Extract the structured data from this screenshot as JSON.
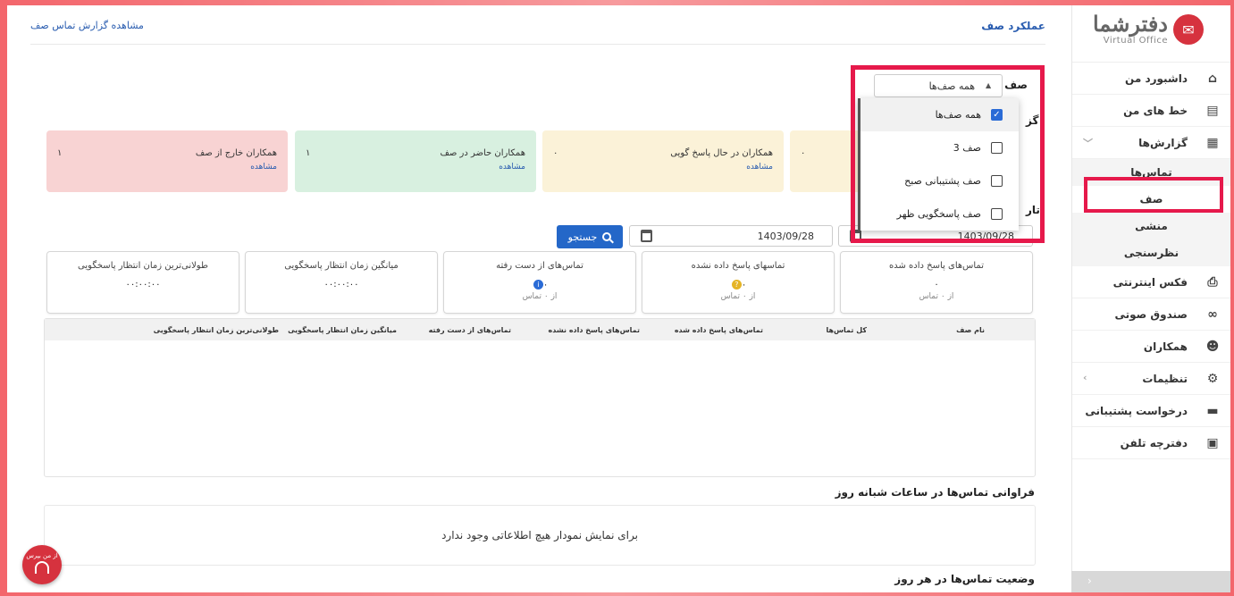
{
  "sidebar": {
    "logo_name": "دفترشما",
    "logo_sub": "Virtual Office",
    "items": [
      {
        "label": "داشبورد من",
        "icon": "home-icon"
      },
      {
        "label": "خط های من",
        "icon": "phone-book-icon"
      },
      {
        "label": "گزارش‌ها",
        "icon": "report-icon"
      },
      {
        "label": "فکس اینترنتی",
        "icon": "fax-icon"
      },
      {
        "label": "صندوق صوتی",
        "icon": "voicemail-icon"
      },
      {
        "label": "همکاران",
        "icon": "users-icon"
      },
      {
        "label": "تنظیمات",
        "icon": "gear-icon"
      },
      {
        "label": "درخواست پشتیبانی",
        "icon": "ticket-icon"
      },
      {
        "label": "دفترچه تلفن",
        "icon": "contacts-icon"
      }
    ],
    "reports_sub": [
      {
        "label": "تماس‌ها"
      },
      {
        "label": "صف"
      },
      {
        "label": "منشی"
      },
      {
        "label": "نظرسنجی"
      }
    ]
  },
  "header": {
    "title": "عملکرد صف",
    "link": "مشاهده گزارش تماس صف"
  },
  "filter": {
    "queue_label": "صف",
    "queue_selected": "همه صف‌ها",
    "options": [
      {
        "label": "همه صف‌ها",
        "checked": true
      },
      {
        "label": "صف 3",
        "checked": false
      },
      {
        "label": "صف پشتیبانی صبح",
        "checked": false
      },
      {
        "label": "صف پاسخگویی ظهر",
        "checked": false
      }
    ],
    "frag_1": "گز",
    "frag_2": "تار"
  },
  "status_cards": [
    {
      "label": "همکاران خارج از صف",
      "count": "۱",
      "link": "مشاهده",
      "bg": "#f8d3d3"
    },
    {
      "label": "همکاران حاضر در صف",
      "count": "۱",
      "link": "مشاهده",
      "bg": "#d8f0e0"
    },
    {
      "label": "همکاران در حال پاسخ گویی",
      "count": "۰",
      "link": "مشاهده",
      "bg": "#fbf2d8"
    },
    {
      "label": "",
      "count": "۰",
      "link": "",
      "bg": "#fbf2d8"
    }
  ],
  "dates": {
    "to": "1403/09/28",
    "from": "1403/09/28",
    "search_label": "جستجو"
  },
  "metrics": [
    {
      "title": "تماس‌های پاسخ داده شده",
      "value": "۰",
      "sub": "از ۰ تماس"
    },
    {
      "title": "تماسهای پاسخ داده نشده",
      "value": "۰",
      "sub": "از ۰ تماس"
    },
    {
      "title": "تماس‌های از دست رفته",
      "value": "۰",
      "sub": "از ۰ تماس"
    },
    {
      "title": "میانگین زمان انتظار پاسخگویی",
      "value": "۰۰:۰۰:۰۰",
      "sub": ""
    },
    {
      "title": "طولانی‌ترین زمان انتظار پاسخگویی",
      "value": "۰۰:۰۰:۰۰",
      "sub": ""
    }
  ],
  "table": {
    "headers": [
      "نام صف",
      "کل تماس‌ها",
      "تماس‌های پاسخ داده شده",
      "تماس‌های پاسخ داده نشده",
      "تماس‌های از دست رفته",
      "میانگین زمان انتظار پاسخگویی",
      "طولانی‌ترین زمان انتظار پاسخگویی"
    ]
  },
  "charts": {
    "hourly_title": "فراوانی تماس‌ها در ساعات شبانه روز",
    "empty_msg": "برای نمایش نمودار هیچ اطلاعاتی وجود ندارد",
    "daily_title": "وضعیت تماس‌ها در هر روز"
  },
  "help": {
    "label": "از من بپرس"
  },
  "colors": {
    "accent": "#2467c8",
    "brand": "#d6323e",
    "highlight": "#e6194b"
  }
}
